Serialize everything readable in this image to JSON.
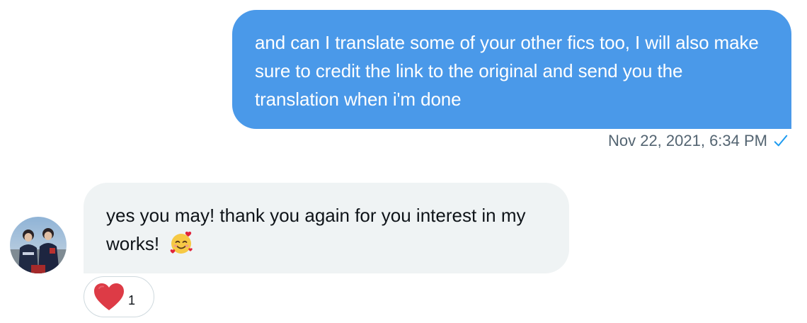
{
  "conversation": {
    "outgoing": {
      "text": "and can I translate some of your other fics too, I will also make sure to credit the link to the original and send you the translation when i'm done",
      "timestamp": "Nov 22, 2021, 6:34 PM",
      "status_icon": "checkmark-icon",
      "bubble_color": "#4a99e9"
    },
    "incoming": {
      "text": "yes you may! thank you again for you interest in my works!",
      "emoji": "smiling-face-with-hearts",
      "bubble_color": "#eff3f4",
      "avatar": "user-avatar-photo",
      "reactions": [
        {
          "icon": "heart-icon",
          "count": "1"
        }
      ]
    }
  },
  "colors": {
    "accent": "#1d9bf0",
    "meta_text": "#536471",
    "heart": "#e0243b"
  }
}
